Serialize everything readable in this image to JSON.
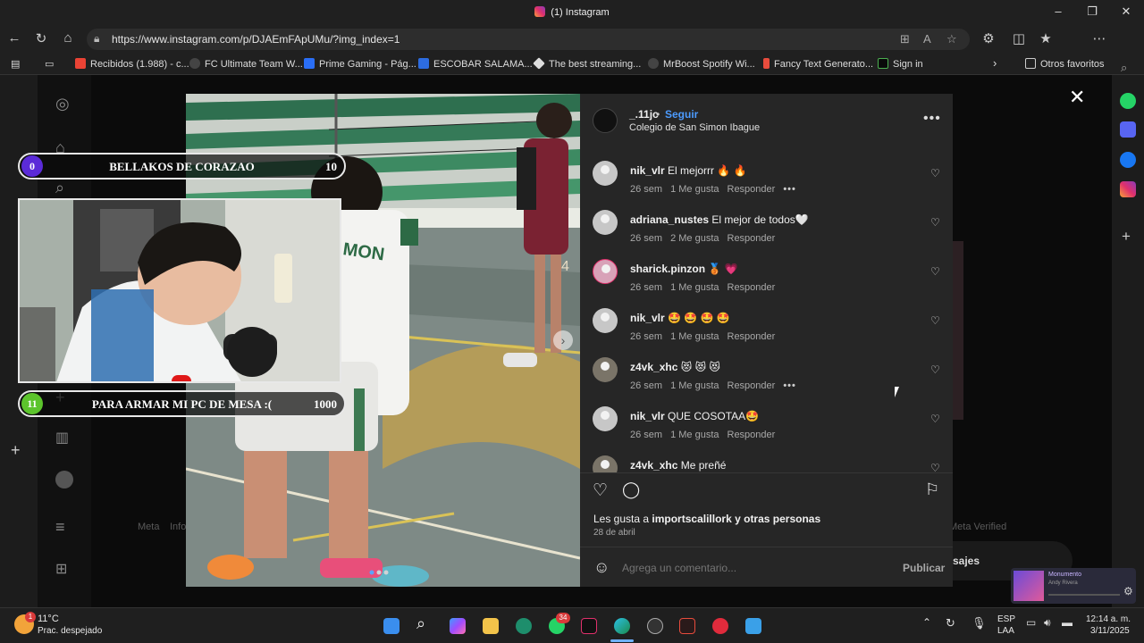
{
  "browser": {
    "window_title": "(1) Instagram",
    "url": "https://www.instagram.com/p/DJAEmFApUMu/?img_index=1",
    "bookmarks": [
      "Recibidos (1.988) - c...",
      "FC Ultimate Team W...",
      "Prime Gaming - Pág...",
      "ESCOBAR SALAMA...",
      "The best streaming...",
      "MrBoost Spotify Wi...",
      "Fancy Text Generato...",
      "Sign in"
    ],
    "other_favorites": "Otros favoritos"
  },
  "post": {
    "username": "_.11jc",
    "dot": "•",
    "follow_label": "Seguir",
    "location": "Colegio de San Simon Ibague",
    "comments": [
      {
        "user": "nik_vlr",
        "text": "El mejorrr 🔥 🔥",
        "time": "26 sem",
        "likes": "1 Me gusta",
        "reply": "Responder",
        "more": true
      },
      {
        "user": "adriana_nustes",
        "text": "El mejor de todos🤍",
        "time": "26 sem",
        "likes": "2 Me gusta",
        "reply": "Responder",
        "more": false
      },
      {
        "user": "sharick.pinzon",
        "text": "🥉 💗",
        "time": "26 sem",
        "likes": "1 Me gusta",
        "reply": "Responder",
        "more": false
      },
      {
        "user": "nik_vlr",
        "text": "🤩 🤩 🤩 🤩",
        "time": "26 sem",
        "likes": "1 Me gusta",
        "reply": "Responder",
        "more": false
      },
      {
        "user": "z4vk_xhc",
        "text": "😻 😻 😻",
        "time": "26 sem",
        "likes": "1 Me gusta",
        "reply": "Responder",
        "more": true
      },
      {
        "user": "nik_vlr",
        "text": "QUE COSOTAA🤩",
        "time": "26 sem",
        "likes": "1 Me gusta",
        "reply": "Responder",
        "more": false
      },
      {
        "user": "z4vk_xhc",
        "text": "Me preñé",
        "time": "",
        "likes": "",
        "reply": "",
        "more": false
      }
    ],
    "likes_prefix": "Les gusta a ",
    "likes_user": "importscalillork",
    "likes_suffix": " y otras personas",
    "date": "28 de abril",
    "comment_placeholder": "Agrega un comentario...",
    "publish_label": "Publicar",
    "shirt_text": "MON",
    "jersey_number": "4"
  },
  "background_page": {
    "footer_left": "Meta",
    "footer_left2": "Info",
    "footer_right": "Meta Verified",
    "messages_label": "sajes"
  },
  "overlay": {
    "top": {
      "left": "0",
      "label": "BELLAKOS DE CORAZAO",
      "right": "10"
    },
    "bottom": {
      "left": "11",
      "label": "PARA ARMAR MI PC DE MESA :(",
      "right": "1000"
    }
  },
  "mini_player": {
    "title": "Monumento",
    "artist": "Andy Rivera"
  },
  "taskbar": {
    "temp": "11°C",
    "weather": "Prac. despejado",
    "weather_badge": "1",
    "whatsapp_badge": "34",
    "lang1": "ESP",
    "lang2": "LAA",
    "time": "12:14 a. m.",
    "date": "3/11/2025"
  }
}
